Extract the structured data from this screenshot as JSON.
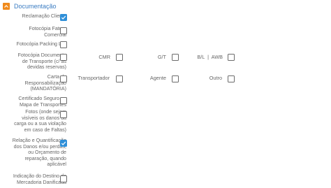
{
  "section": {
    "title": "Documentação",
    "toggle_icon": "chevron-up-icon",
    "accent_color": "#f08a1c",
    "title_color": "#3a7cc2",
    "check_color": "#2f8fd8"
  },
  "rows": {
    "reclamacao": {
      "label": "Reclamação Cliente",
      "checked": true
    },
    "fatura": {
      "line1": "Fotocópia Fatura",
      "line2": "Comercial",
      "checked": false
    },
    "packing": {
      "label": "Fotocópia Packing List",
      "checked": false
    },
    "transporte": {
      "line1": "Fotocópia Documento",
      "line2": "de Transporte (c/ as",
      "line3": "devidas reservas)",
      "checked": false,
      "cmr": {
        "label": "CMR",
        "checked": false
      },
      "gt": {
        "label": "G/T",
        "checked": false
      },
      "bl": {
        "label": "B/L  |  AWB",
        "checked": false
      }
    },
    "carta": {
      "line1": "Carta de",
      "line2": "Responsabilização",
      "line3": "(MANDATÓRIA)",
      "checked": false,
      "transportador": {
        "label": "Transportador",
        "checked": false
      },
      "agente": {
        "label": "Agente",
        "checked": false
      },
      "outro": {
        "label": "Outro",
        "checked": false
      }
    },
    "certificado": {
      "line1": "Certificado Seguro ou",
      "line2": "Mapa de Transportes",
      "checked": false
    },
    "fotos": {
      "line1": "Fotos (onde sejam",
      "line2": "visíveis os danos da",
      "line3": "carga ou a sua violação",
      "line4": "em caso de Faltas)",
      "checked": false
    },
    "relacao": {
      "line1": "Relação e Quantificação",
      "line2": "dos Danos e/ou perdas,",
      "line3": "ou Orçamento de",
      "line4": "reparação, quando",
      "line5": "aplicável",
      "checked": true
    },
    "destino": {
      "line1": "Indicação do Destino da",
      "line2": "Mercadoria Danificada",
      "checked": false
    }
  }
}
